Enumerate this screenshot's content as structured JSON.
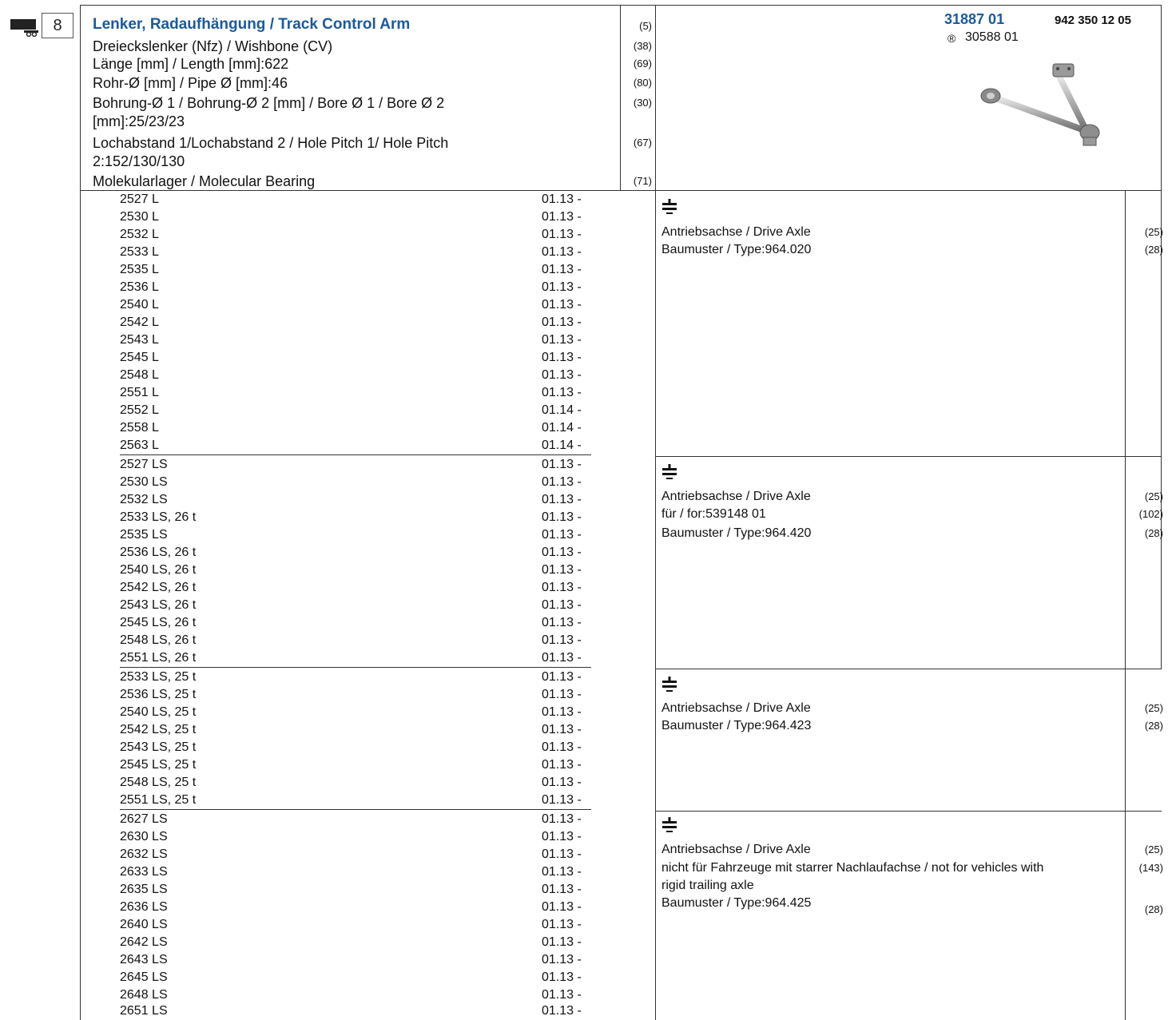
{
  "badge": {
    "section_number": "8",
    "icon": "truck-trailer-icon"
  },
  "header": {
    "title": "Lenker, Radaufhängung / Track Control Arm",
    "title_code": "(5)",
    "attributes": [
      {
        "lines": [
          "Dreieckslenker (Nfz) / Wishbone (CV)"
        ],
        "code": "(38)"
      },
      {
        "lines": [
          "Länge [mm] / Length [mm]:622"
        ],
        "code": "(69)"
      },
      {
        "lines": [
          "Rohr-Ø [mm] / Pipe Ø [mm]:46"
        ],
        "code": "(80)"
      },
      {
        "lines": [
          "Bohrung-Ø 1 / Bohrung-Ø 2 [mm] / Bore Ø 1 / Bore Ø 2",
          "[mm]:25/23/23"
        ],
        "code": "(30)"
      },
      {
        "lines": [
          "Lochabstand 1/Lochabstand 2 / Hole Pitch 1/ Hole Pitch",
          "2:152/130/130"
        ],
        "code": "(67)"
      },
      {
        "lines": [
          "Molekularlager / Molecular Bearing"
        ],
        "code": "(71)"
      }
    ],
    "part_number": "31887 01",
    "oe_number": "942 350 12 05",
    "reference_symbol": "®",
    "reference_number": "30588 01",
    "image_icon": "track-control-arm-image"
  },
  "groups": [
    {
      "models": [
        [
          "2527 L",
          "01.13 -"
        ],
        [
          "2530 L",
          "01.13 -"
        ],
        [
          "2532 L",
          "01.13 -"
        ],
        [
          "2533 L",
          "01.13 -"
        ],
        [
          "2535 L",
          "01.13 -"
        ],
        [
          "2536 L",
          "01.13 -"
        ],
        [
          "2540 L",
          "01.13 -"
        ],
        [
          "2542 L",
          "01.13 -"
        ],
        [
          "2543 L",
          "01.13 -"
        ],
        [
          "2545 L",
          "01.13 -"
        ],
        [
          "2548 L",
          "01.13 -"
        ],
        [
          "2551 L",
          "01.13 -"
        ],
        [
          "2552 L",
          "01.14 -"
        ],
        [
          "2558 L",
          "01.14 -"
        ],
        [
          "2563 L",
          "01.14 -"
        ]
      ],
      "icon": "axle-icon",
      "notes": [
        {
          "lines": [
            "Antriebsachse / Drive Axle"
          ],
          "code": "(25)"
        },
        {
          "lines": [
            "Baumuster / Type:964.020"
          ],
          "code": "(28)"
        }
      ]
    },
    {
      "models": [
        [
          "2527 LS",
          "01.13 -"
        ],
        [
          "2530 LS",
          "01.13 -"
        ],
        [
          "2532 LS",
          "01.13 -"
        ],
        [
          "2533 LS, 26 t",
          "01.13 -"
        ],
        [
          "2535 LS",
          "01.13 -"
        ],
        [
          "2536 LS, 26 t",
          "01.13 -"
        ],
        [
          "2540 LS, 26 t",
          "01.13 -"
        ],
        [
          "2542 LS, 26 t",
          "01.13 -"
        ],
        [
          "2543 LS, 26 t",
          "01.13 -"
        ],
        [
          "2545 LS, 26 t",
          "01.13 -"
        ],
        [
          "2548 LS, 26 t",
          "01.13 -"
        ],
        [
          "2551 LS, 26 t",
          "01.13 -"
        ]
      ],
      "icon": "axle-icon",
      "notes": [
        {
          "lines": [
            "Antriebsachse / Drive Axle"
          ],
          "code": "(25)"
        },
        {
          "lines": [
            "für / for:539148 01"
          ],
          "code": "(102)"
        },
        {
          "lines": [
            "Baumuster / Type:964.420"
          ],
          "code": "(28)"
        }
      ]
    },
    {
      "models": [
        [
          "2533 LS, 25 t",
          "01.13 -"
        ],
        [
          "2536 LS, 25 t",
          "01.13 -"
        ],
        [
          "2540 LS, 25 t",
          "01.13 -"
        ],
        [
          "2542 LS, 25 t",
          "01.13 -"
        ],
        [
          "2543 LS, 25 t",
          "01.13 -"
        ],
        [
          "2545 LS, 25 t",
          "01.13 -"
        ],
        [
          "2548 LS, 25 t",
          "01.13 -"
        ],
        [
          "2551 LS, 25 t",
          "01.13 -"
        ]
      ],
      "icon": "axle-icon",
      "notes": [
        {
          "lines": [
            "Antriebsachse / Drive Axle"
          ],
          "code": "(25)"
        },
        {
          "lines": [
            "Baumuster / Type:964.423"
          ],
          "code": "(28)"
        }
      ]
    },
    {
      "models": [
        [
          "2627 LS",
          "01.13 -"
        ],
        [
          "2630 LS",
          "01.13 -"
        ],
        [
          "2632 LS",
          "01.13 -"
        ],
        [
          "2633 LS",
          "01.13 -"
        ],
        [
          "2635 LS",
          "01.13 -"
        ],
        [
          "2636 LS",
          "01.13 -"
        ],
        [
          "2640 LS",
          "01.13 -"
        ],
        [
          "2642 LS",
          "01.13 -"
        ],
        [
          "2643 LS",
          "01.13 -"
        ],
        [
          "2645 LS",
          "01.13 -"
        ],
        [
          "2648 LS",
          "01.13 -"
        ],
        [
          "2651 LS",
          "01.13 -"
        ]
      ],
      "icon": "axle-icon",
      "notes": [
        {
          "lines": [
            "Antriebsachse / Drive Axle"
          ],
          "code": "(25)"
        },
        {
          "lines": [
            "nicht für Fahrzeuge mit starrer Nachlaufachse / not for vehicles with",
            "rigid trailing axle"
          ],
          "code": "(143)"
        },
        {
          "lines": [
            "Baumuster / Type:964.425"
          ],
          "code": "(28)"
        }
      ]
    }
  ]
}
